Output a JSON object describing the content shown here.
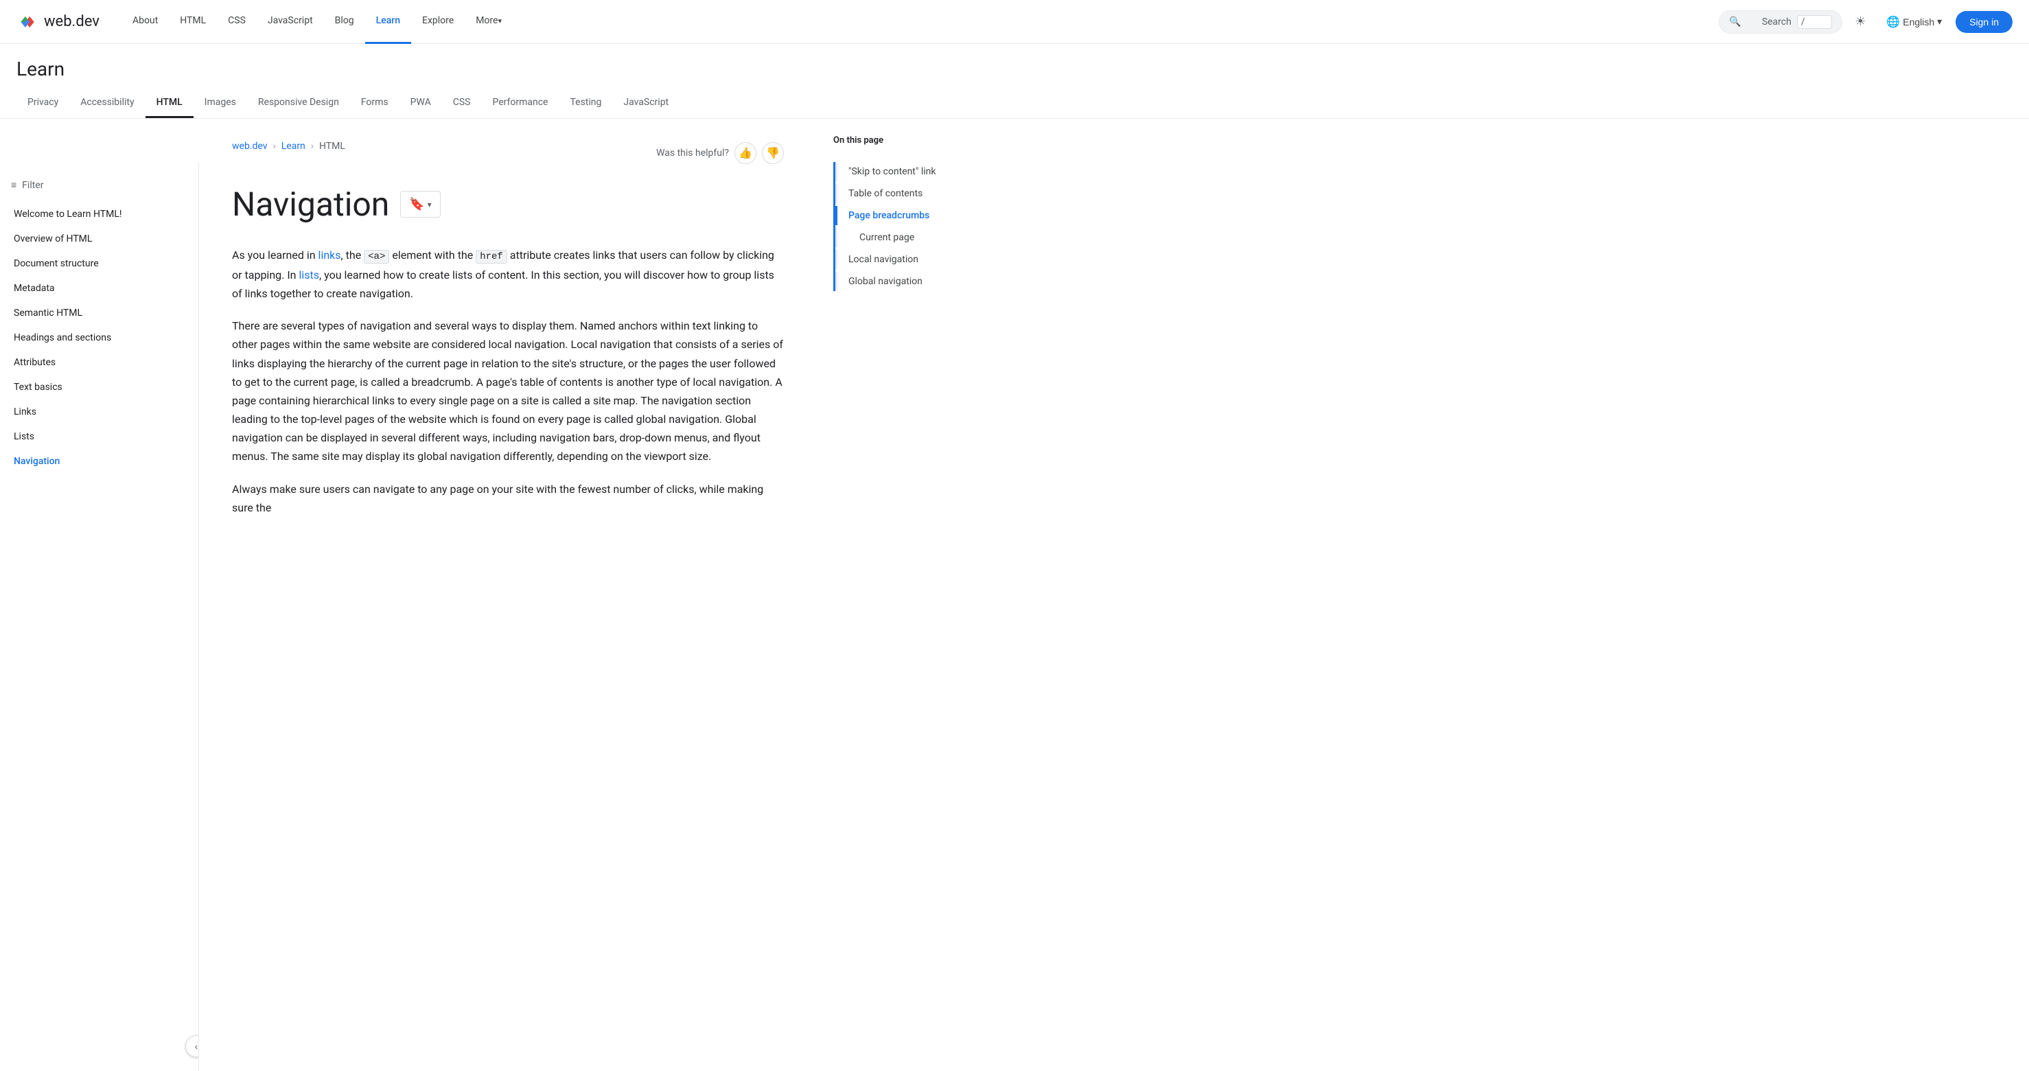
{
  "topNav": {
    "logoText": "web.dev",
    "links": [
      {
        "label": "About",
        "active": false
      },
      {
        "label": "HTML",
        "active": false
      },
      {
        "label": "CSS",
        "active": false
      },
      {
        "label": "JavaScript",
        "active": false
      },
      {
        "label": "Blog",
        "active": false
      },
      {
        "label": "Learn",
        "active": true
      },
      {
        "label": "Explore",
        "active": false
      },
      {
        "label": "More",
        "active": false,
        "hasArrow": true
      }
    ],
    "searchPlaceholder": "Search",
    "searchShortcut": "/",
    "language": "English",
    "signIn": "Sign in"
  },
  "learnHeader": {
    "title": "Learn"
  },
  "categoryTabs": [
    {
      "label": "Privacy",
      "active": false
    },
    {
      "label": "Accessibility",
      "active": false
    },
    {
      "label": "HTML",
      "active": true
    },
    {
      "label": "Images",
      "active": false
    },
    {
      "label": "Responsive Design",
      "active": false
    },
    {
      "label": "Forms",
      "active": false
    },
    {
      "label": "PWA",
      "active": false
    },
    {
      "label": "CSS",
      "active": false
    },
    {
      "label": "Performance",
      "active": false
    },
    {
      "label": "Testing",
      "active": false
    },
    {
      "label": "JavaScript",
      "active": false
    }
  ],
  "sidebar": {
    "filterPlaceholder": "Filter",
    "items": [
      {
        "label": "Welcome to Learn HTML!",
        "active": false
      },
      {
        "label": "Overview of HTML",
        "active": false
      },
      {
        "label": "Document structure",
        "active": false
      },
      {
        "label": "Metadata",
        "active": false
      },
      {
        "label": "Semantic HTML",
        "active": false
      },
      {
        "label": "Headings and sections",
        "active": false
      },
      {
        "label": "Attributes",
        "active": false
      },
      {
        "label": "Text basics",
        "active": false
      },
      {
        "label": "Links",
        "active": false
      },
      {
        "label": "Lists",
        "active": false
      },
      {
        "label": "Navigation",
        "active": true
      }
    ]
  },
  "content": {
    "breadcrumb": {
      "items": [
        "web.dev",
        "Learn",
        "HTML"
      ]
    },
    "helpfulText": "Was this helpful?",
    "pageTitle": "Navigation",
    "paragraphs": [
      "As you learned in [links], the [<a>] element with the [href] attribute creates links that users can follow by clicking or tapping. In [lists], you learned how to create lists of content. In this section, you will discover how to group lists of links together to create navigation.",
      "There are several types of navigation and several ways to display them. Named anchors within text linking to other pages within the same website are considered local navigation. Local navigation that consists of a series of links displaying the hierarchy of the current page in relation to the site's structure, or the pages the user followed to get to the current page, is called a breadcrumb. A page's table of contents is another type of local navigation. A page containing hierarchical links to every single page on a site is called a site map. The navigation section leading to the top-level pages of the website which is found on every page is called global navigation. Global navigation can be displayed in several different ways, including navigation bars, drop-down menus, and flyout menus. The same site may display its global navigation differently, depending on the viewport size.",
      "Always make sure users can navigate to any page on your site with the fewest number of clicks, while making sure the"
    ]
  },
  "toc": {
    "title": "On this page",
    "items": [
      {
        "label": "\"Skip to content\" link",
        "active": false,
        "sub": false
      },
      {
        "label": "Table of contents",
        "active": false,
        "sub": false
      },
      {
        "label": "Page breadcrumbs",
        "active": true,
        "sub": false
      },
      {
        "label": "Current page",
        "active": false,
        "sub": true
      },
      {
        "label": "Local navigation",
        "active": false,
        "sub": false
      },
      {
        "label": "Global navigation",
        "active": false,
        "sub": false
      }
    ]
  }
}
